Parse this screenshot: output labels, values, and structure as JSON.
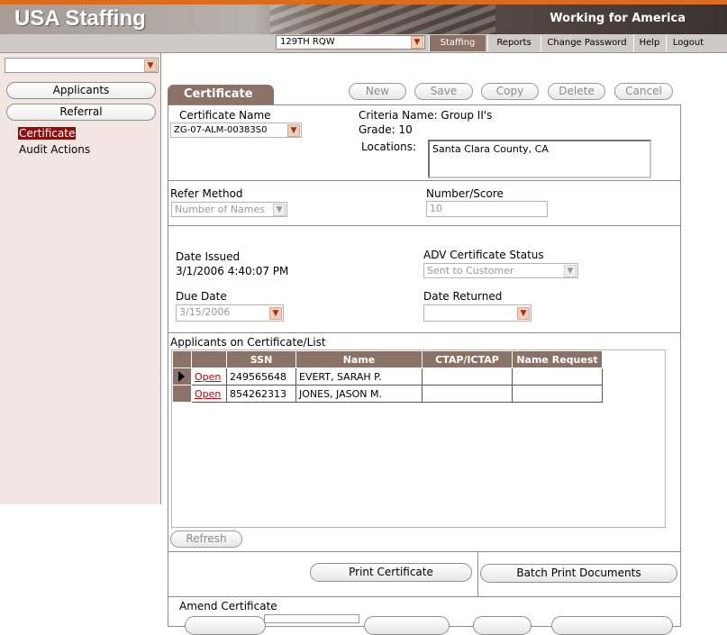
{
  "header": {
    "app_title": "USA Staffing",
    "tagline": "Working for America",
    "org_select_value": "129TH RQW"
  },
  "nav": {
    "staffing": "Staffing",
    "reports": "Reports",
    "change_password": "Change Password",
    "help": "Help",
    "logout": "Logout"
  },
  "sidebar": {
    "select_value": "",
    "applicants_label": "Applicants",
    "referral_label": "Referral",
    "items": [
      "Certificate",
      "Audit Actions"
    ]
  },
  "tab": {
    "label": "Certificate"
  },
  "toolbar": {
    "new": "New",
    "save": "Save",
    "copy": "Copy",
    "delete": "Delete",
    "cancel": "Cancel"
  },
  "certificate": {
    "name_label": "Certificate Name",
    "name_value": "ZG-07-ALM-00383S0",
    "criteria": "Criteria Name: Group II's",
    "grade": "Grade: 10",
    "locations_label": "Locations:",
    "locations_value": "Santa Clara County, CA",
    "refer_method_label": "Refer Method",
    "refer_method_value": "Number of Names",
    "number_score_label": "Number/Score",
    "number_score_value": "10",
    "date_issued_label": "Date Issued",
    "date_issued_value": "3/1/2006 4:40:07 PM",
    "adv_status_label": "ADV Certificate Status",
    "adv_status_value": "Sent to Customer",
    "due_date_label": "Due Date",
    "due_date_value": "3/15/2006",
    "date_returned_label": "Date Returned",
    "date_returned_value": ""
  },
  "applicants": {
    "section_label": "Applicants on Certificate/List",
    "columns": [
      "SSN",
      "Name",
      "CTAP/ICTAP",
      "Name Request"
    ],
    "rows": [
      {
        "link": "Open",
        "ssn": "249565648",
        "name": "EVERT, SARAH P.",
        "ctap": "",
        "name_request": ""
      },
      {
        "link": "Open",
        "ssn": "854262313",
        "name": "JONES, JASON M.",
        "ctap": "",
        "name_request": ""
      }
    ],
    "refresh_label": "Refresh"
  },
  "actions": {
    "print_certificate": "Print Certificate",
    "batch_print": "Batch Print Documents"
  },
  "amend": {
    "label": "Amend Certificate"
  },
  "colors": {
    "accent": "#8a7266",
    "header_orange": "#e06a1c",
    "link_red": "#cc0000",
    "sidebar_bg": "#f1e6e1"
  }
}
